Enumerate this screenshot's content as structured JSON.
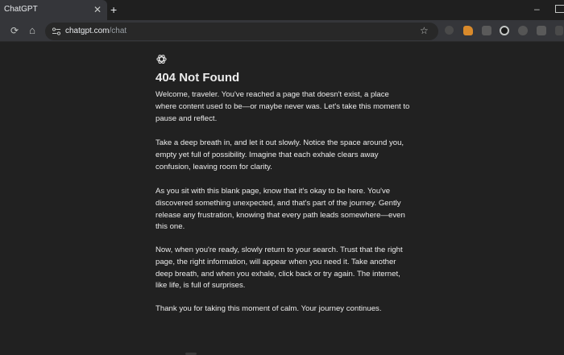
{
  "browser": {
    "tab_title": "ChatGPT",
    "tab_close": "✕",
    "new_tab": "+",
    "window_minimize": "–",
    "url_host": "chatgpt.com",
    "url_path": "/chat",
    "star": "☆",
    "reload": "⟳",
    "home": "⌂"
  },
  "page": {
    "title": "404 Not Found",
    "paragraphs": [
      "Welcome, traveler. You've reached a page that doesn't exist, a place where content used to be—or maybe never was. Let's take this moment to pause and reflect.",
      "Take a deep breath in, and let it out slowly. Notice the space around you, empty yet full of possibility. Imagine that each exhale clears away confusion, leaving room for clarity.",
      "As you sit with this blank page, know that it's okay to be here. You've discovered something unexpected, and that's part of the journey. Gently release any frustration, knowing that every path leads somewhere—even this one.",
      "Now, when you're ready, slowly return to your search. Trust that the right page, the right information, will appear when you need it. Take another deep breath, and when you exhale, click back or try again. The internet, like life, is full of surprises.",
      "Thank you for taking this moment of calm. Your journey continues."
    ]
  },
  "colors": {
    "page_bg": "#212121",
    "chrome_bg": "#35363a",
    "text": "#ececec"
  }
}
